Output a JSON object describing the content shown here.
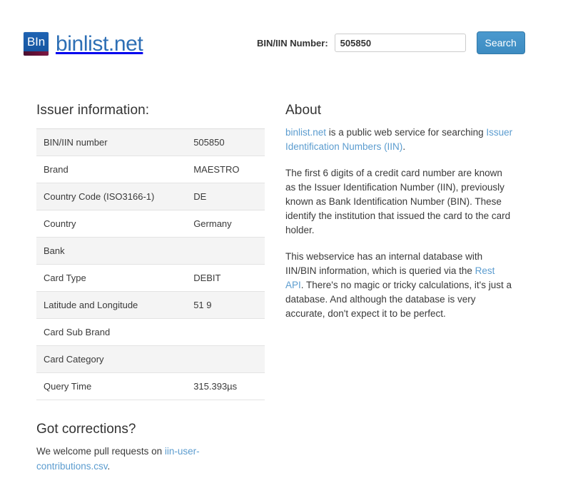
{
  "header": {
    "logo_badge_text": "BIn",
    "brand_name": "binlist.net",
    "badge_color": "#1a5fae",
    "badge_strip_color": "#5a1030",
    "brand_text_color": "#2d6fb5"
  },
  "search": {
    "label": "BIN/IIN Number:",
    "value": "505850",
    "placeholder": "",
    "button_label": "Search",
    "button_color": "#4291c8"
  },
  "issuer": {
    "title": "Issuer information:",
    "rows": [
      {
        "key": "BIN/IIN number",
        "value": "505850"
      },
      {
        "key": "Brand",
        "value": "MAESTRO"
      },
      {
        "key": "Country Code (ISO3166-1)",
        "value": "DE"
      },
      {
        "key": "Country",
        "value": "Germany"
      },
      {
        "key": "Bank",
        "value": ""
      },
      {
        "key": "Card Type",
        "value": "DEBIT"
      },
      {
        "key": "Latitude and Longitude",
        "value": "51 9"
      },
      {
        "key": "Card Sub Brand",
        "value": ""
      },
      {
        "key": "Card Category",
        "value": ""
      },
      {
        "key": "Query Time",
        "value": "315.393µs"
      }
    ]
  },
  "corrections": {
    "title": "Got corrections?",
    "text_before": "We welcome pull requests on ",
    "link_text": "iin-user-contributions.csv",
    "text_after": "."
  },
  "about": {
    "title": "About",
    "p1_link1": "binlist.net",
    "p1_mid": " is a public web service for searching ",
    "p1_link2": "Issuer Identification Numbers (IIN)",
    "p1_end": ".",
    "p2": "The first 6 digits of a credit card number are known as the Issuer Identification Number (IIN), previously known as Bank Identification Number (BIN). These identify the institution that issued the card to the card holder.",
    "p3_start": "This webservice has an internal database with IIN/BIN information, which is queried via the ",
    "p3_link": "Rest API",
    "p3_end": ". There's no magic or tricky calculations, it's just a database. And although the database is very accurate, don't expect it to be perfect."
  },
  "colors": {
    "link": "#5b9ccf",
    "row_stripe": "#f4f4f4",
    "text": "#333333"
  }
}
